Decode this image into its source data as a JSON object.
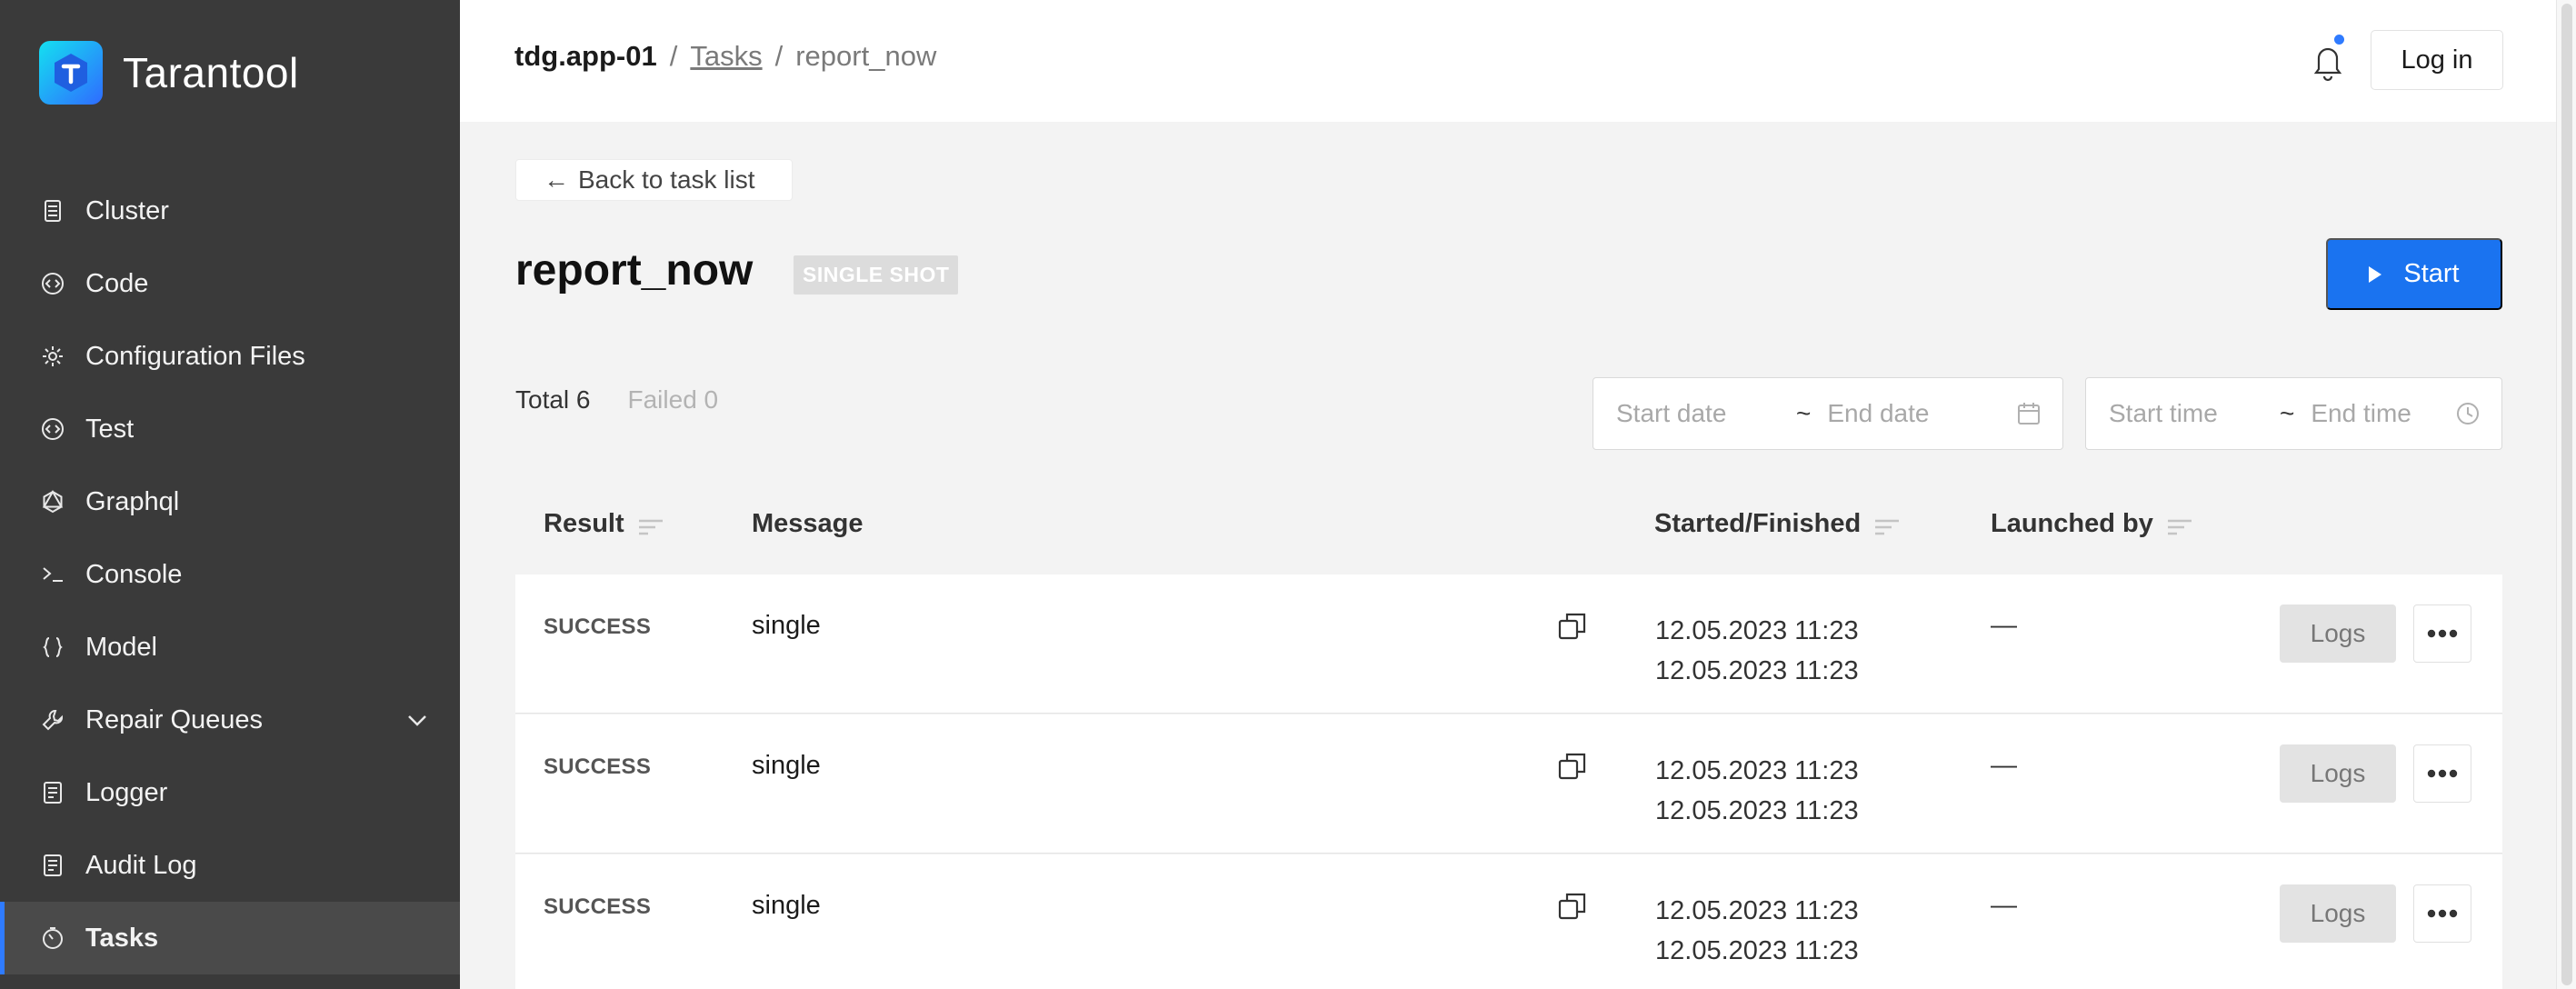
{
  "app": {
    "name": "Tarantool"
  },
  "sidebar": {
    "items": [
      {
        "label": "Cluster",
        "icon": "cluster-icon"
      },
      {
        "label": "Code",
        "icon": "code-icon"
      },
      {
        "label": "Configuration Files",
        "icon": "gear-icon"
      },
      {
        "label": "Test",
        "icon": "test-icon"
      },
      {
        "label": "Graphql",
        "icon": "graphql-icon"
      },
      {
        "label": "Console",
        "icon": "console-icon"
      },
      {
        "label": "Model",
        "icon": "model-icon"
      },
      {
        "label": "Repair Queues",
        "icon": "wrench-icon",
        "expandable": true
      },
      {
        "label": "Logger",
        "icon": "logger-icon"
      },
      {
        "label": "Audit Log",
        "icon": "audit-log-icon"
      },
      {
        "label": "Tasks",
        "icon": "tasks-icon",
        "active": true
      }
    ]
  },
  "header": {
    "breadcrumb": {
      "root": "tdg.app-01",
      "separator": "/",
      "link": "Tasks",
      "current": "report_now"
    },
    "login_label": "Log in"
  },
  "main": {
    "back_label": "Back to task list",
    "title": "report_now",
    "badge": "SINGLE SHOT",
    "start_label": "Start",
    "stats": {
      "total": "Total 6",
      "failed": "Failed 0"
    },
    "date_picker": {
      "start_placeholder": "Start date",
      "end_placeholder": "End date",
      "separator": "~"
    },
    "time_picker": {
      "start_placeholder": "Start time",
      "end_placeholder": "End time",
      "separator": "~"
    }
  },
  "table": {
    "headers": {
      "result": "Result",
      "message": "Message",
      "started_finished": "Started/Finished",
      "launched_by": "Launched by"
    },
    "rows": [
      {
        "result": "SUCCESS",
        "message": "single",
        "started": "12.05.2023 11:23",
        "finished": "12.05.2023 11:23",
        "launched_by": "—",
        "logs_label": "Logs"
      },
      {
        "result": "SUCCESS",
        "message": "single",
        "started": "12.05.2023 11:23",
        "finished": "12.05.2023 11:23",
        "launched_by": "—",
        "logs_label": "Logs"
      },
      {
        "result": "SUCCESS",
        "message": "single",
        "started": "12.05.2023 11:23",
        "finished": "12.05.2023 11:23",
        "launched_by": "—",
        "logs_label": "Logs"
      }
    ]
  },
  "colors": {
    "accent": "#1a73f0",
    "sidebar_bg": "#3a3a3a",
    "page_bg": "#f3f3f3"
  }
}
